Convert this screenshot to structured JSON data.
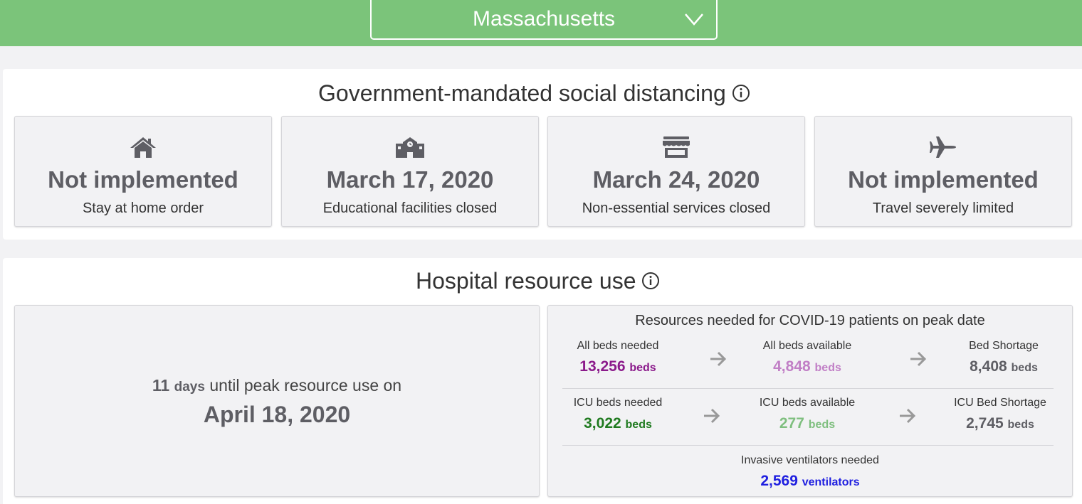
{
  "header": {
    "state_selector": "Massachusetts",
    "chevron_icon": "chevron-down-icon",
    "background_color": "#7bc47a"
  },
  "social_distancing": {
    "title": "Government-mandated social distancing",
    "info_icon": "info-icon",
    "cards": [
      {
        "icon": "home-icon",
        "value": "Not implemented",
        "label": "Stay at home order"
      },
      {
        "icon": "school-icon",
        "value": "March 17, 2020",
        "label": "Educational facilities closed"
      },
      {
        "icon": "store-icon",
        "value": "March 24, 2020",
        "label": "Non-essential services closed"
      },
      {
        "icon": "airplane-icon",
        "value": "Not implemented",
        "label": "Travel severely limited"
      }
    ]
  },
  "hospital": {
    "title": "Hospital resource use",
    "info_icon": "info-icon",
    "peak": {
      "days_value": "11",
      "days_unit": "days",
      "days_text": "until peak resource use on",
      "date": "April 18, 2020"
    },
    "resources": {
      "heading": "Resources needed for COVID-19 patients on peak date",
      "rows": [
        {
          "needed": {
            "label": "All beds needed",
            "value": "13,256",
            "unit": "beds",
            "color": "#8b1a8b"
          },
          "available": {
            "label": "All beds available",
            "value": "4,848",
            "unit": "beds",
            "color": "#c17fc6"
          },
          "shortage": {
            "label": "Bed Shortage",
            "value": "8,408",
            "unit": "beds",
            "color": "#5e5e64"
          }
        },
        {
          "needed": {
            "label": "ICU beds needed",
            "value": "3,022",
            "unit": "beds",
            "color": "#1f7a1f"
          },
          "available": {
            "label": "ICU beds available",
            "value": "277",
            "unit": "beds",
            "color": "#7fbf7f"
          },
          "shortage": {
            "label": "ICU Bed Shortage",
            "value": "2,745",
            "unit": "beds",
            "color": "#5e5e64"
          }
        }
      ],
      "ventilators": {
        "label": "Invasive ventilators needed",
        "value": "2,569",
        "unit": "ventilators",
        "color": "#1f1fe0"
      }
    }
  }
}
